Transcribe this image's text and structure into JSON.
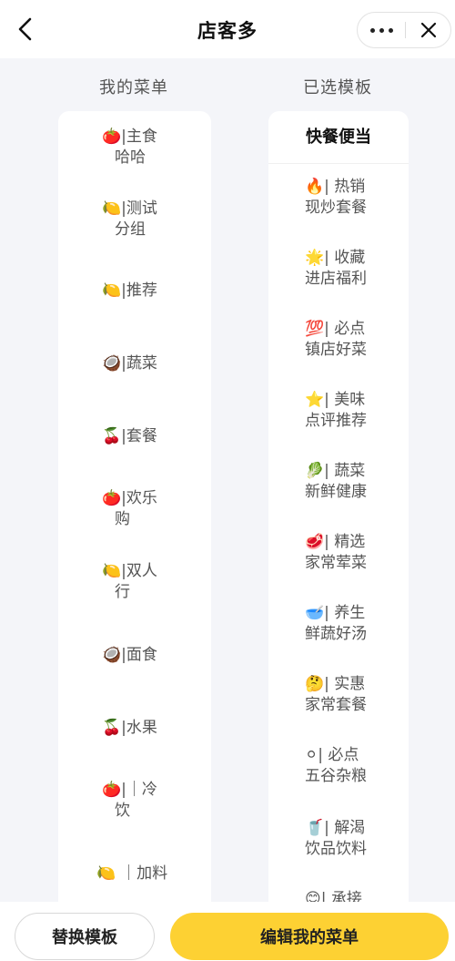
{
  "nav": {
    "title": "店客多"
  },
  "columns": {
    "left_title": "我的菜单",
    "right_title": "已选模板"
  },
  "left_items": [
    {
      "emoji": "🍅",
      "line1": "|主食",
      "line2": "哈哈"
    },
    {
      "emoji": "🍋",
      "line1": "|测试",
      "line2": "分组"
    },
    {
      "emoji": "🍋",
      "line1": "|推荐",
      "line2": ""
    },
    {
      "emoji": "🥥",
      "line1": "|蔬菜",
      "line2": ""
    },
    {
      "emoji": "🍒",
      "line1": "|套餐",
      "line2": ""
    },
    {
      "emoji": "🍅",
      "line1": "|欢乐",
      "line2": "购"
    },
    {
      "emoji": "🍋",
      "line1": "|双人",
      "line2": "行"
    },
    {
      "emoji": "🥥",
      "line1": "|面食",
      "line2": ""
    },
    {
      "emoji": "🍒",
      "line1": "|水果",
      "line2": ""
    },
    {
      "emoji": "🍅",
      "line1": "|｜冷",
      "line2": "饮"
    },
    {
      "emoji": "🍋",
      "line1": "｜加料",
      "line2": ""
    }
  ],
  "template": {
    "name": "快餐便当",
    "items": [
      {
        "emoji": "🔥",
        "line1": "| 热销",
        "line2": "现炒套餐"
      },
      {
        "emoji": "🌟",
        "line1": "| 收藏",
        "line2": "进店福利"
      },
      {
        "emoji": "💯",
        "line1": "| 必点",
        "line2": "镇店好菜"
      },
      {
        "emoji": "⭐",
        "line1": "| 美味",
        "line2": "点评推荐"
      },
      {
        "emoji": "🥬",
        "line1": "| 蔬菜",
        "line2": "新鲜健康"
      },
      {
        "emoji": "🥩",
        "line1": "| 精选",
        "line2": "家常荤菜"
      },
      {
        "emoji": "🥣",
        "line1": "| 养生",
        "line2": "鲜蔬好汤"
      },
      {
        "emoji": "🤔",
        "line1": "| 实惠",
        "line2": "家常套餐"
      },
      {
        "emoji": "⚪",
        "line1": "| 必点",
        "line2": "五谷杂粮"
      },
      {
        "emoji": "🥤",
        "line1": "| 解渴",
        "line2": "饮品饮料"
      },
      {
        "emoji": "😊",
        "line1": "| 承接",
        "line2": ""
      }
    ]
  },
  "buttons": {
    "replace": "替换模板",
    "edit": "编辑我的菜单"
  },
  "colors": {
    "accent": "#fdd133",
    "background": "#f4f5f9"
  }
}
